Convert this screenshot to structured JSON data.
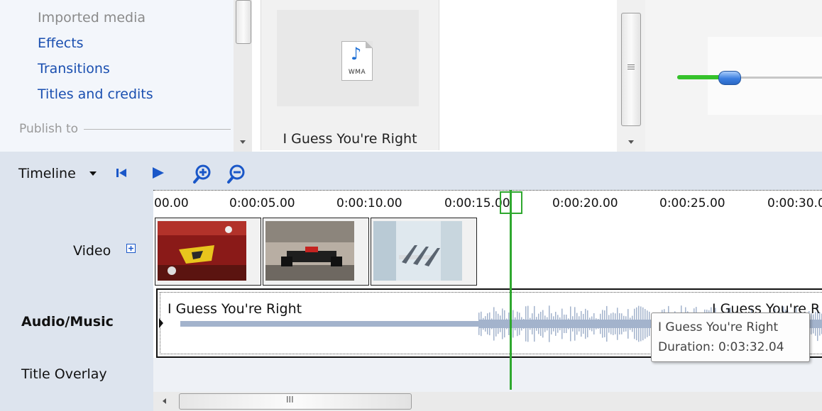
{
  "tasks": {
    "items": [
      {
        "label": "Imported media",
        "enabled": false
      },
      {
        "label": "Effects",
        "enabled": true
      },
      {
        "label": "Transitions",
        "enabled": true
      },
      {
        "label": "Titles and credits",
        "enabled": true
      }
    ],
    "publish_header": "Publish to"
  },
  "collection": {
    "item": {
      "caption": "I Guess You're Right",
      "file_type": "WMA"
    }
  },
  "monitor": {
    "volume_fraction": 0.25
  },
  "timeline": {
    "view_label": "Timeline",
    "ruler_ticks": [
      "00.00",
      "0:00:05.00",
      "0:00:10.00",
      "0:00:15.00",
      "0:00:20.00",
      "0:00:25.00",
      "0:00:30.0"
    ],
    "tracks": {
      "video": "Video",
      "audio": "Audio/Music",
      "overlay": "Title Overlay"
    },
    "audio_clip_titles": [
      "I Guess You're Right",
      "I Guess You're R"
    ],
    "tooltip": {
      "title": "I Guess You're Right",
      "duration": "Duration:  0:03:32.04"
    },
    "scroll_grip": "III"
  },
  "colors": {
    "link": "#1a4fb0",
    "playhead": "#2fa82f",
    "waveform": "#a3b3cc",
    "panel_bg": "#dde4ee"
  }
}
